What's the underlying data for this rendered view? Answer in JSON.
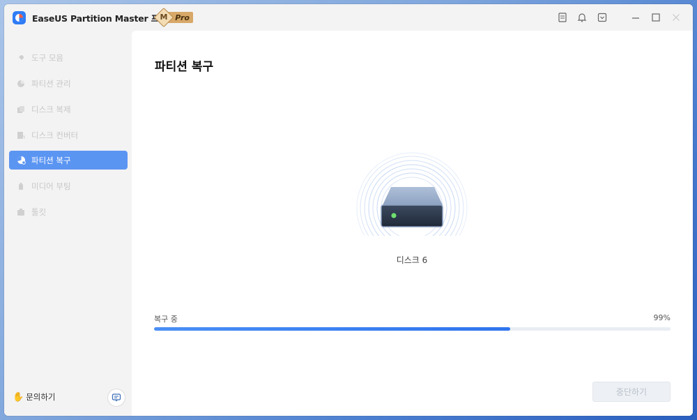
{
  "app": {
    "title": "EaseUS Partition Master 프로 버전",
    "badge_letter": "M",
    "badge_text": "Pro"
  },
  "sidebar": {
    "items": [
      {
        "label": "도구 모음",
        "icon": "rocket-icon",
        "active": false
      },
      {
        "label": "파티션 관리",
        "icon": "pie-chart-icon",
        "active": false
      },
      {
        "label": "디스크 복제",
        "icon": "copy-icon",
        "active": false
      },
      {
        "label": "디스크 컨버터",
        "icon": "convert-icon",
        "active": false
      },
      {
        "label": "파티션 복구",
        "icon": "partition-recovery-icon",
        "active": true
      },
      {
        "label": "미디어 부팅",
        "icon": "usb-icon",
        "active": false
      },
      {
        "label": "툴킷",
        "icon": "toolkit-icon",
        "active": false
      }
    ],
    "contact_label": "문의하기"
  },
  "main": {
    "title": "파티션 복구",
    "disk_label": "디스크 6",
    "progress": {
      "label": "복구 중",
      "percent_text": "99%",
      "fill_fraction": 0.69
    },
    "stop_button": "중단하기"
  },
  "colors": {
    "accent": "#5b95f2",
    "progress": "#2f75ee",
    "led": "#6fe06f"
  }
}
